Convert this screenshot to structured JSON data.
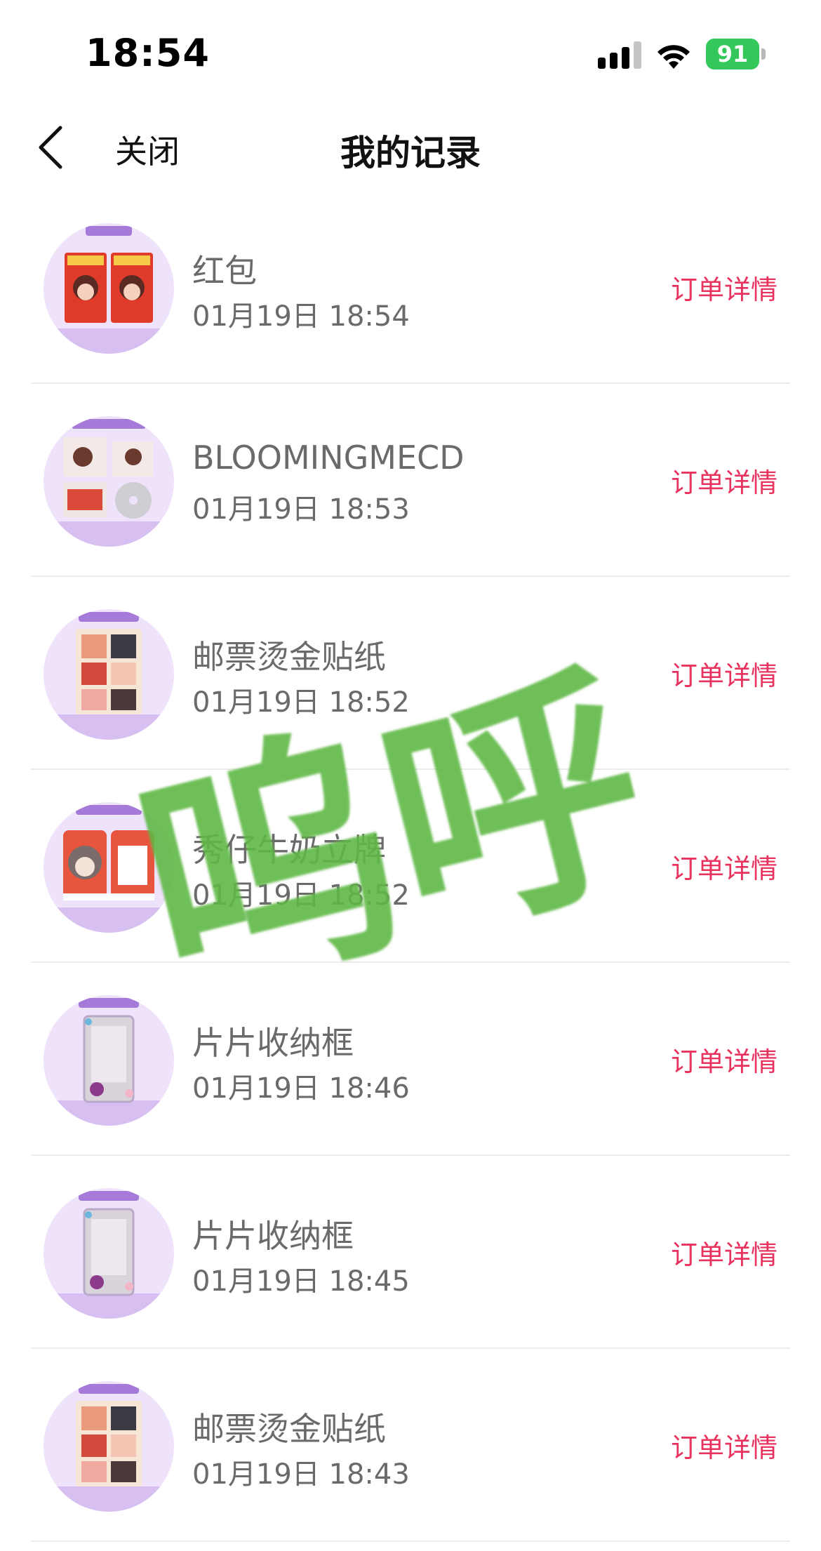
{
  "status_bar": {
    "time": "18:54",
    "battery": "91"
  },
  "nav": {
    "close_label": "关闭",
    "title": "我的记录"
  },
  "records": [
    {
      "name": "红包",
      "time": "01月19日 18:54",
      "action": "订单详情",
      "thumb_icon": "red-envelope-thumbnail"
    },
    {
      "name": "BLOOMINGMECD",
      "time": "01月19日 18:53",
      "action": "订单详情",
      "thumb_icon": "cd-album-thumbnail"
    },
    {
      "name": "邮票烫金贴纸",
      "time": "01月19日 18:52",
      "action": "订单详情",
      "thumb_icon": "stamp-sticker-thumbnail"
    },
    {
      "name": "秀仔牛奶立牌",
      "time": "01月19日 18:52",
      "action": "订单详情",
      "thumb_icon": "milk-stand-thumbnail"
    },
    {
      "name": "片片收纳框",
      "time": "01月19日 18:46",
      "action": "订单详情",
      "thumb_icon": "card-frame-thumbnail"
    },
    {
      "name": "片片收纳框",
      "time": "01月19日 18:45",
      "action": "订单详情",
      "thumb_icon": "card-frame-thumbnail"
    },
    {
      "name": "邮票烫金贴纸",
      "time": "01月19日 18:43",
      "action": "订单详情",
      "thumb_icon": "stamp-sticker-thumbnail"
    }
  ],
  "watermark": "呜呼",
  "colors": {
    "accent": "#e8335e",
    "battery": "#34c759",
    "thumb_bg": "#efe3fb",
    "watermark": "#5fb846"
  }
}
